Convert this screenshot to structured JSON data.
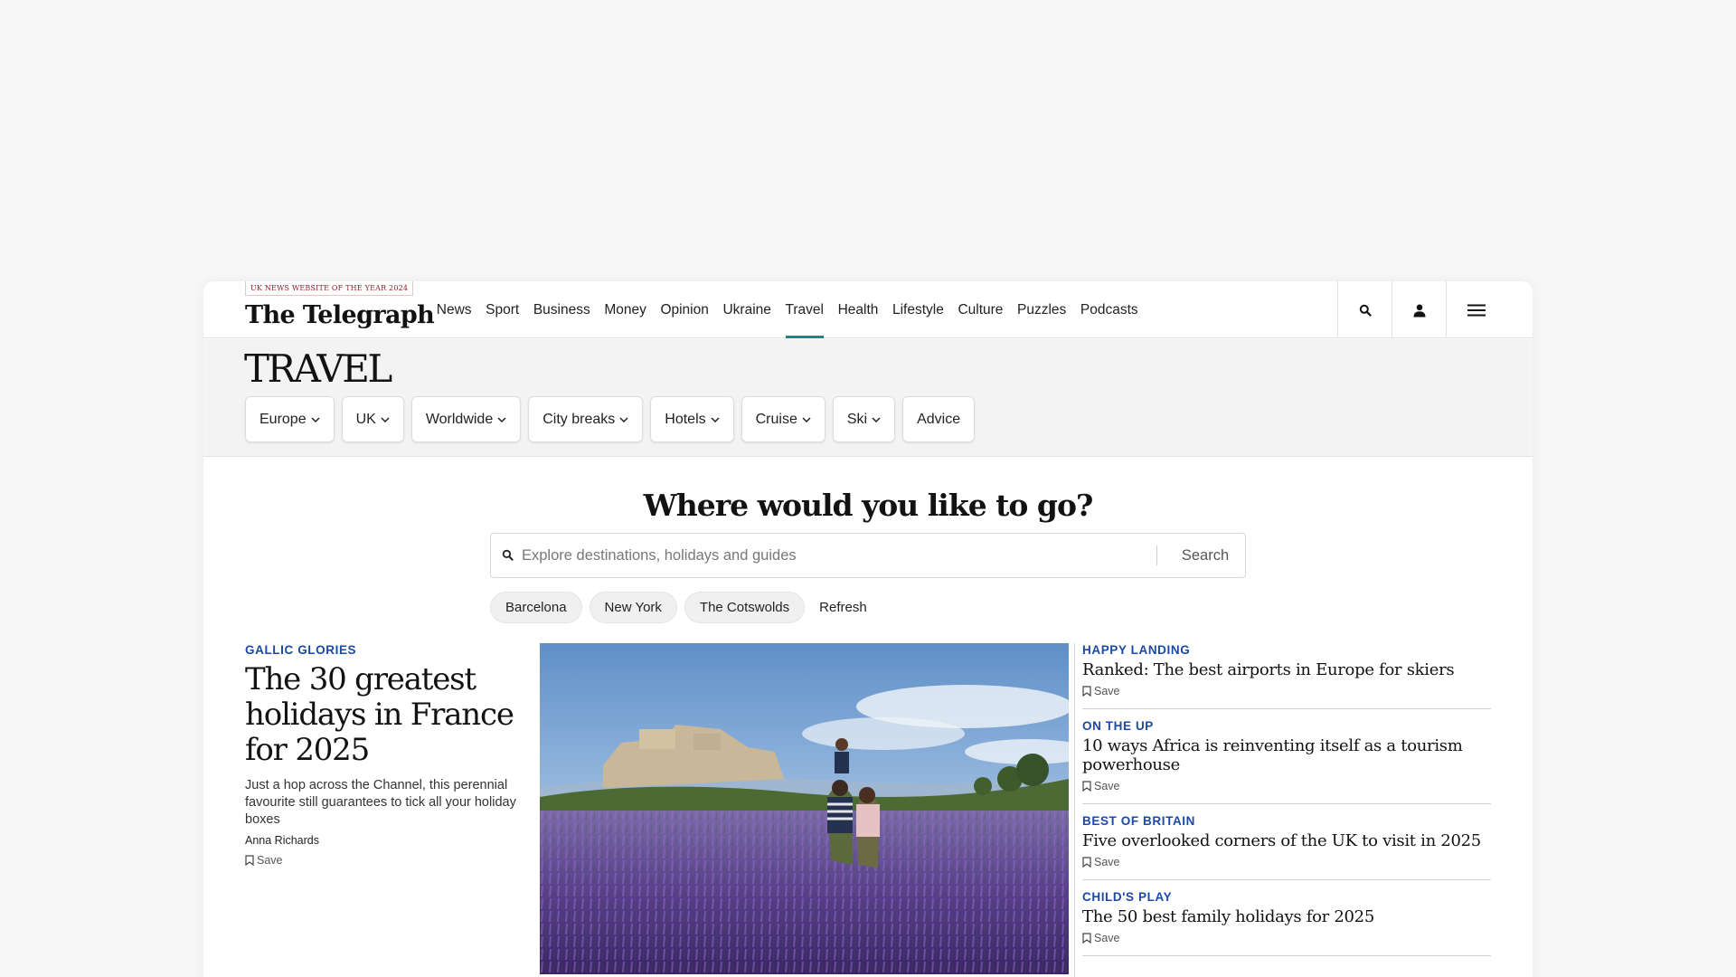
{
  "brand": {
    "award": "UK NEWS WEBSITE OF THE YEAR 2024",
    "logo": "The Telegraph",
    "accent": "#0f8c84",
    "kicker_color": "#1a49a8"
  },
  "nav": {
    "items": [
      {
        "label": "News"
      },
      {
        "label": "Sport"
      },
      {
        "label": "Business"
      },
      {
        "label": "Money"
      },
      {
        "label": "Opinion"
      },
      {
        "label": "Ukraine"
      },
      {
        "label": "Travel",
        "active": true
      },
      {
        "label": "Health"
      },
      {
        "label": "Lifestyle"
      },
      {
        "label": "Culture"
      },
      {
        "label": "Puzzles"
      },
      {
        "label": "Podcasts"
      }
    ],
    "icons": [
      "search-icon",
      "account-icon",
      "menu-icon"
    ]
  },
  "section": {
    "title": "TRAVEL",
    "subnav": [
      {
        "label": "Europe",
        "dropdown": true
      },
      {
        "label": "UK",
        "dropdown": true
      },
      {
        "label": "Worldwide",
        "dropdown": true
      },
      {
        "label": "City breaks",
        "dropdown": true
      },
      {
        "label": "Hotels",
        "dropdown": true
      },
      {
        "label": "Cruise",
        "dropdown": true
      },
      {
        "label": "Ski",
        "dropdown": true
      },
      {
        "label": "Advice",
        "dropdown": false
      }
    ]
  },
  "search": {
    "headline": "Where would you like to go?",
    "placeholder": "Explore destinations, holidays and guides",
    "button": "Search",
    "suggestions": [
      "Barcelona",
      "New York",
      "The Cotswolds"
    ],
    "refresh": "Refresh"
  },
  "lead_story": {
    "kicker": "GALLIC GLORIES",
    "title": "The 30 greatest holidays in France for 2025",
    "summary": "Just a hop across the Channel, this perennial favourite still guarantees to tick all your holiday boxes",
    "author": "Anna Richards",
    "save": "Save"
  },
  "side_stories": [
    {
      "kicker": "HAPPY LANDING",
      "title": "Ranked: The best airports in Europe for skiers",
      "save": "Save"
    },
    {
      "kicker": "ON THE UP",
      "title": "10 ways Africa is reinventing itself as a tourism powerhouse",
      "save": "Save"
    },
    {
      "kicker": "BEST OF BRITAIN",
      "title": "Five overlooked corners of the UK to visit in 2025",
      "save": "Save"
    },
    {
      "kicker": "CHILD'S PLAY",
      "title": "The 50 best family holidays for 2025",
      "save": "Save"
    }
  ]
}
